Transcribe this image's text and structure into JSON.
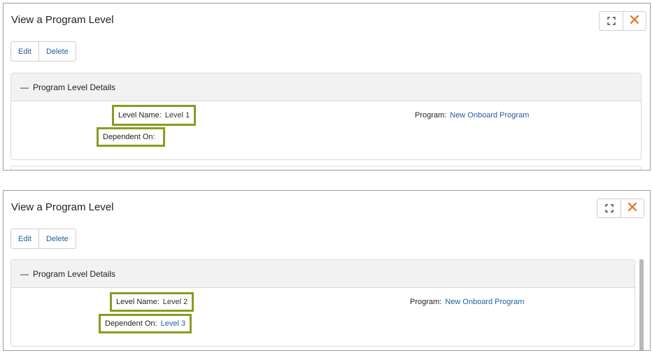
{
  "panels": [
    {
      "title": "View a Program Level",
      "actions": {
        "edit": "Edit",
        "delete": "Delete"
      },
      "section": {
        "toggle": "—",
        "title": "Program Level Details",
        "level_name_label": "Level Name:",
        "level_name_value": "Level 1",
        "dependent_on_label": "Dependent On:",
        "dependent_on_value": "",
        "program_label": "Program:",
        "program_value": "New Onboard Program"
      },
      "window_controls": {
        "maximize_icon": "expand-icon",
        "close_icon": "close-icon"
      }
    },
    {
      "title": "View a Program Level",
      "actions": {
        "edit": "Edit",
        "delete": "Delete"
      },
      "section": {
        "toggle": "—",
        "title": "Program Level Details",
        "level_name_label": "Level Name:",
        "level_name_value": "Level 2",
        "dependent_on_label": "Dependent On:",
        "dependent_on_value": "Level 3",
        "program_label": "Program:",
        "program_value": "New Onboard Program"
      },
      "window_controls": {
        "maximize_icon": "expand-icon",
        "close_icon": "close-icon"
      }
    }
  ],
  "colors": {
    "highlight_border": "#8a9b21",
    "link": "#1f5fa3",
    "close_icon": "#e8721e"
  }
}
